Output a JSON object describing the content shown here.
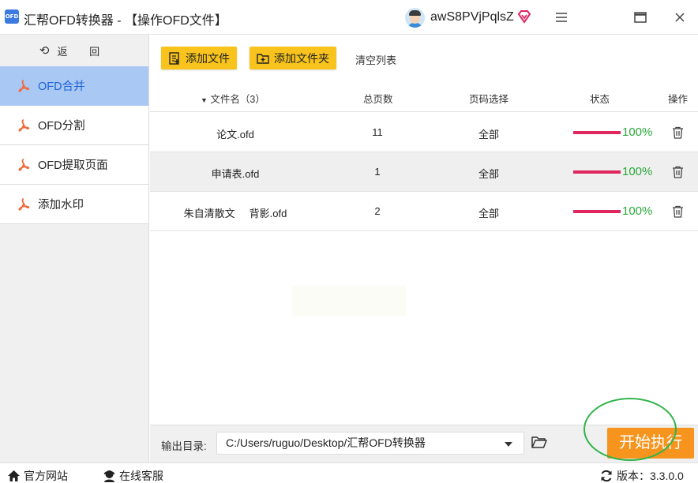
{
  "window": {
    "app_logo_text": "OFD",
    "title": "汇帮OFD转换器 - 【操作OFD文件】",
    "username": "awS8PVjPqlsZ"
  },
  "sidebar": {
    "back_label": "返 回",
    "items": [
      {
        "label": "OFD合并",
        "active": true
      },
      {
        "label": "OFD分割",
        "active": false
      },
      {
        "label": "OFD提取页面",
        "active": false
      },
      {
        "label": "添加水印",
        "active": false
      }
    ]
  },
  "toolbar": {
    "add_file": "添加文件",
    "add_folder": "添加文件夹",
    "clear_list": "清空列表"
  },
  "table": {
    "headers": {
      "name": "文件名（3）",
      "pages": "总页数",
      "range": "页码选择",
      "status": "状态",
      "action": "操作"
    },
    "rows": [
      {
        "name": "论文.ofd",
        "pages": "11",
        "range": "全部",
        "progress": 1.0,
        "progress_text": "100%"
      },
      {
        "name": "申请表.ofd",
        "pages": "1",
        "range": "全部",
        "progress": 1.0,
        "progress_text": "100%"
      },
      {
        "name": "朱自清散文     背影.ofd",
        "pages": "2",
        "range": "全部",
        "progress": 1.0,
        "progress_text": "100%"
      }
    ]
  },
  "output": {
    "label": "输出目录:",
    "path": "C:/Users/ruguo/Desktop/汇帮OFD转换器",
    "start_button": "开始执行"
  },
  "statusbar": {
    "website": "官方网站",
    "service": "在线客服",
    "version": "版本：3.3.0.0"
  },
  "colors": {
    "accent_yellow": "#f7c31c",
    "start_orange": "#f7941d",
    "active_nav": "#a9c8f3",
    "progress_red": "#e0265f",
    "success_green": "#2aa83a"
  }
}
